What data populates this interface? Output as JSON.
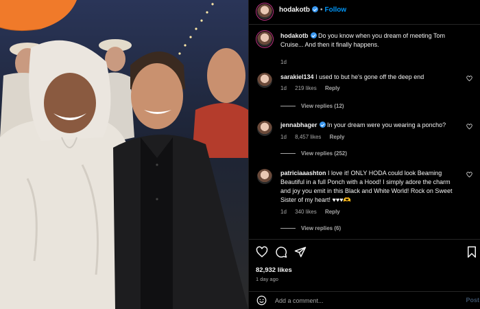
{
  "post": {
    "username": "hodakotb",
    "follow_label": "Follow",
    "separator": "•",
    "caption": "Do you know when you dream of meeting Tom Cruise... And then it finally happens.",
    "caption_time": "1d"
  },
  "comments": [
    {
      "username": "sarakiel134",
      "text": "I used to but he's gone off the deep end",
      "time": "1d",
      "likes": "219 likes",
      "reply_label": "Reply",
      "view_replies": "View replies (12)"
    },
    {
      "username": "jennabhager",
      "text": "In your dream were you wearing a poncho?",
      "time": "1d",
      "likes": "8,457 likes",
      "reply_label": "Reply",
      "view_replies": "View replies (252)"
    },
    {
      "username": "patriciaaashton",
      "text": "I love it! ONLY HODA could look Beaming Beautiful in a full Ponch with a Hood! I simply adore the charm and joy you emit in this Black and White World! Rock on Sweet Sister of my heart! ♥♥♥🫶",
      "time": "1d",
      "likes": "340 likes",
      "reply_label": "Reply",
      "view_replies": "View replies (6)"
    }
  ],
  "actions": {
    "icons": [
      "heart-icon",
      "comment-icon",
      "share-icon",
      "bookmark-icon"
    ],
    "likes": "82,932 likes",
    "time_ago": "1 day ago"
  },
  "composer": {
    "placeholder": "Add a comment...",
    "post_label": "Post"
  },
  "colors": {
    "background": "#000000",
    "link_blue": "#0095f6",
    "verified_blue": "#3897f0",
    "secondary_text": "#a8a8a8"
  }
}
